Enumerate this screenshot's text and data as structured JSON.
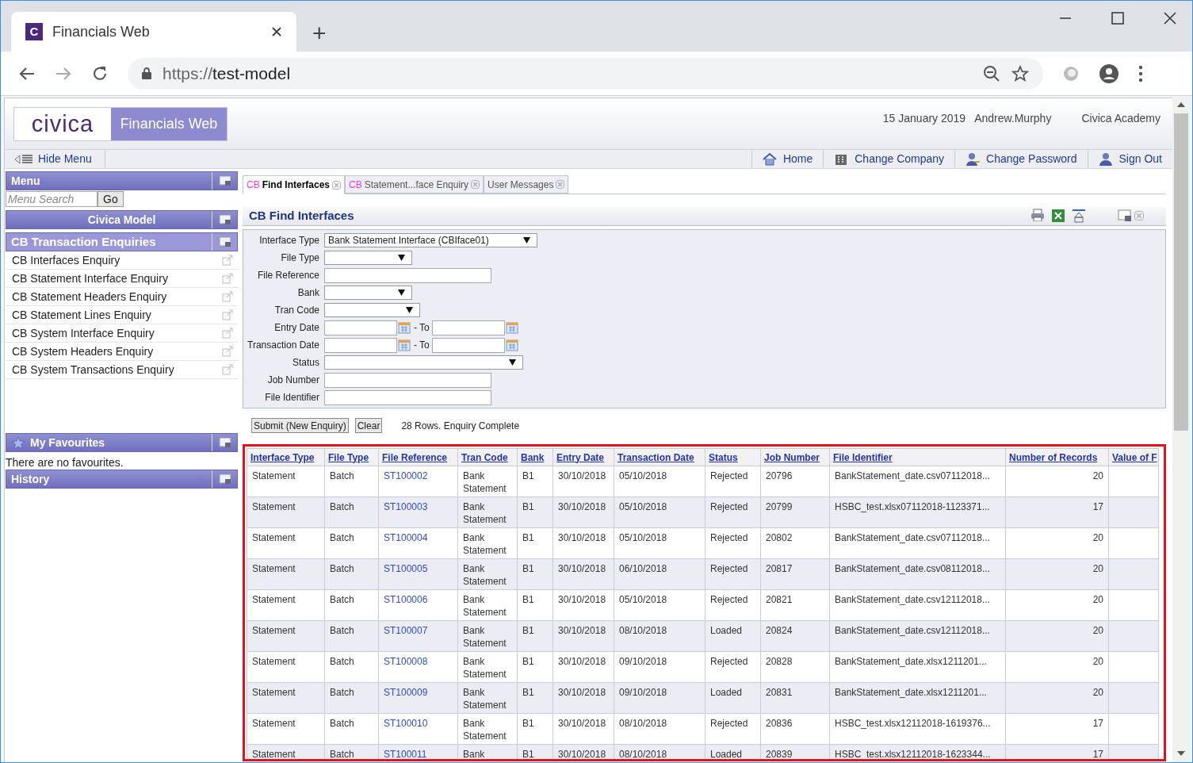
{
  "browser": {
    "favicon": "C",
    "tab_title": "Financials Web",
    "new_tab": "+",
    "url_scheme": "https://",
    "url_host": "test-model"
  },
  "header": {
    "logo": "civica",
    "product": "Financials Web",
    "date": "15 January 2019",
    "user": "Andrew.Murphy",
    "company": "Civica Academy"
  },
  "nav": {
    "hide_menu": "Hide Menu",
    "links": [
      {
        "label": "Home",
        "kind": "home"
      },
      {
        "label": "Change Company",
        "kind": "company"
      },
      {
        "label": "Change Password",
        "kind": "password"
      },
      {
        "label": "Sign Out",
        "kind": "signout"
      }
    ]
  },
  "sidebar": {
    "menu_title": "Menu",
    "search_placeholder": "Menu Search",
    "search_button": "Go",
    "model_title": "Civica Model",
    "section_title": "CB Transaction Enquiries",
    "items": [
      "CB Interfaces Enquiry",
      "CB Statement Interface Enquiry",
      "CB Statement Headers Enquiry",
      "CB Statement Lines Enquiry",
      "CB System Interface Enquiry",
      "CB System Headers Enquiry",
      "CB System Transactions Enquiry"
    ],
    "favourites_title": "My Favourites",
    "favourites_text": "There are no favourites.",
    "history_title": "History"
  },
  "tabs": [
    {
      "prefix": "CB",
      "label": "Find Interfaces",
      "selected": true
    },
    {
      "prefix": "CB",
      "label": "Statement...face Enquiry",
      "selected": false
    },
    {
      "label": "User Messages",
      "selected": false
    }
  ],
  "panel": {
    "title": "CB Find Interfaces",
    "fields": [
      {
        "label": "Interface Type",
        "kind": "select",
        "value": "Bank Statement Interface (CBIface01)"
      },
      {
        "label": "File Type",
        "kind": "select"
      },
      {
        "label": "File Reference",
        "kind": "text"
      },
      {
        "label": "Bank",
        "kind": "select"
      },
      {
        "label": "Tran Code",
        "kind": "select"
      },
      {
        "label": "Entry Date",
        "kind": "daterange",
        "to": "- To"
      },
      {
        "label": "Transaction Date",
        "kind": "daterange",
        "to": "- To"
      },
      {
        "label": "Status",
        "kind": "select"
      },
      {
        "label": "Job Number",
        "kind": "text"
      },
      {
        "label": "File Identifier",
        "kind": "text"
      }
    ],
    "buttons": [
      "Submit (New Enquiry)",
      "Clear"
    ],
    "status": "28 Rows. Enquiry Complete"
  },
  "table": {
    "columns": [
      {
        "label": "Interface Type",
        "kind": "text"
      },
      {
        "label": "File Type",
        "kind": "text"
      },
      {
        "label": "File Reference",
        "kind": "link"
      },
      {
        "label": "Tran Code",
        "kind": "text"
      },
      {
        "label": "Bank",
        "kind": "text"
      },
      {
        "label": "Entry Date",
        "kind": "text"
      },
      {
        "label": "Transaction Date",
        "kind": "text"
      },
      {
        "label": "Status",
        "kind": "text"
      },
      {
        "label": "Job Number",
        "kind": "text"
      },
      {
        "label": "File Identifier",
        "kind": "text"
      },
      {
        "label": "Number of Records",
        "kind": "number"
      },
      {
        "label": "Value of F",
        "kind": "text"
      }
    ],
    "rows": [
      [
        "Statement",
        "Batch",
        "ST100002",
        "Bank Statement",
        "B1",
        "30/10/2018",
        "05/10/2018",
        "Rejected",
        "20796",
        "BankStatement_date.csv07112018...",
        "20"
      ],
      [
        "Statement",
        "Batch",
        "ST100003",
        "Bank Statement",
        "B1",
        "30/10/2018",
        "05/10/2018",
        "Rejected",
        "20799",
        "HSBC_test.xlsx07112018-1123371...",
        "17"
      ],
      [
        "Statement",
        "Batch",
        "ST100004",
        "Bank Statement",
        "B1",
        "30/10/2018",
        "05/10/2018",
        "Rejected",
        "20802",
        "BankStatement_date.csv07112018...",
        "20"
      ],
      [
        "Statement",
        "Batch",
        "ST100005",
        "Bank Statement",
        "B1",
        "30/10/2018",
        "06/10/2018",
        "Rejected",
        "20817",
        "BankStatement_date.csv08112018...",
        "20"
      ],
      [
        "Statement",
        "Batch",
        "ST100006",
        "Bank Statement",
        "B1",
        "30/10/2018",
        "05/10/2018",
        "Rejected",
        "20821",
        "BankStatement_date.csv12112018...",
        "20"
      ],
      [
        "Statement",
        "Batch",
        "ST100007",
        "Bank Statement",
        "B1",
        "30/10/2018",
        "08/10/2018",
        "Loaded",
        "20824",
        "BankStatement_date.csv12112018...",
        "20"
      ],
      [
        "Statement",
        "Batch",
        "ST100008",
        "Bank Statement",
        "B1",
        "30/10/2018",
        "09/10/2018",
        "Rejected",
        "20828",
        "BankStatement_date.xlsx1211201...",
        "20"
      ],
      [
        "Statement",
        "Batch",
        "ST100009",
        "Bank Statement",
        "B1",
        "30/10/2018",
        "09/10/2018",
        "Loaded",
        "20831",
        "BankStatement_date.xlsx1211201...",
        "20"
      ],
      [
        "Statement",
        "Batch",
        "ST100010",
        "Bank Statement",
        "B1",
        "30/10/2018",
        "08/10/2018",
        "Rejected",
        "20836",
        "HSBC_test.xlsx12112018-1619376...",
        "17"
      ],
      [
        "Statement",
        "Batch",
        "ST100011",
        "Bank",
        "B1",
        "30/10/2018",
        "08/10/2018",
        "Loaded",
        "20839",
        "HSBC_test.xlsx12112018-1623344...",
        "17"
      ]
    ]
  }
}
